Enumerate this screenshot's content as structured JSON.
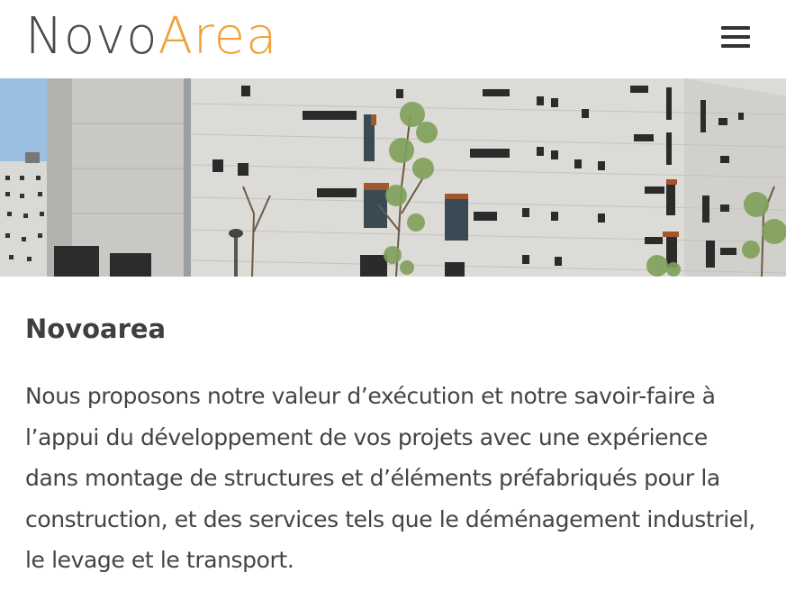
{
  "header": {
    "logo_part1": "Novo",
    "logo_part2": "Area",
    "menu_icon": "hamburger-menu-icon",
    "colors": {
      "logo_dark": "#4a4a4a",
      "logo_accent": "#f0a23a"
    }
  },
  "hero": {
    "image_description_icon": "building-photo"
  },
  "main": {
    "title": "Novoarea",
    "paragraph": "Nous proposons notre valeur d’exécution et notre savoir-faire à l’appui du développement de vos projets avec une expérience dans montage de structures et d’éléments préfabriqués pour la construction, et des services tels que le déménagement industriel, le levage et le transport."
  }
}
